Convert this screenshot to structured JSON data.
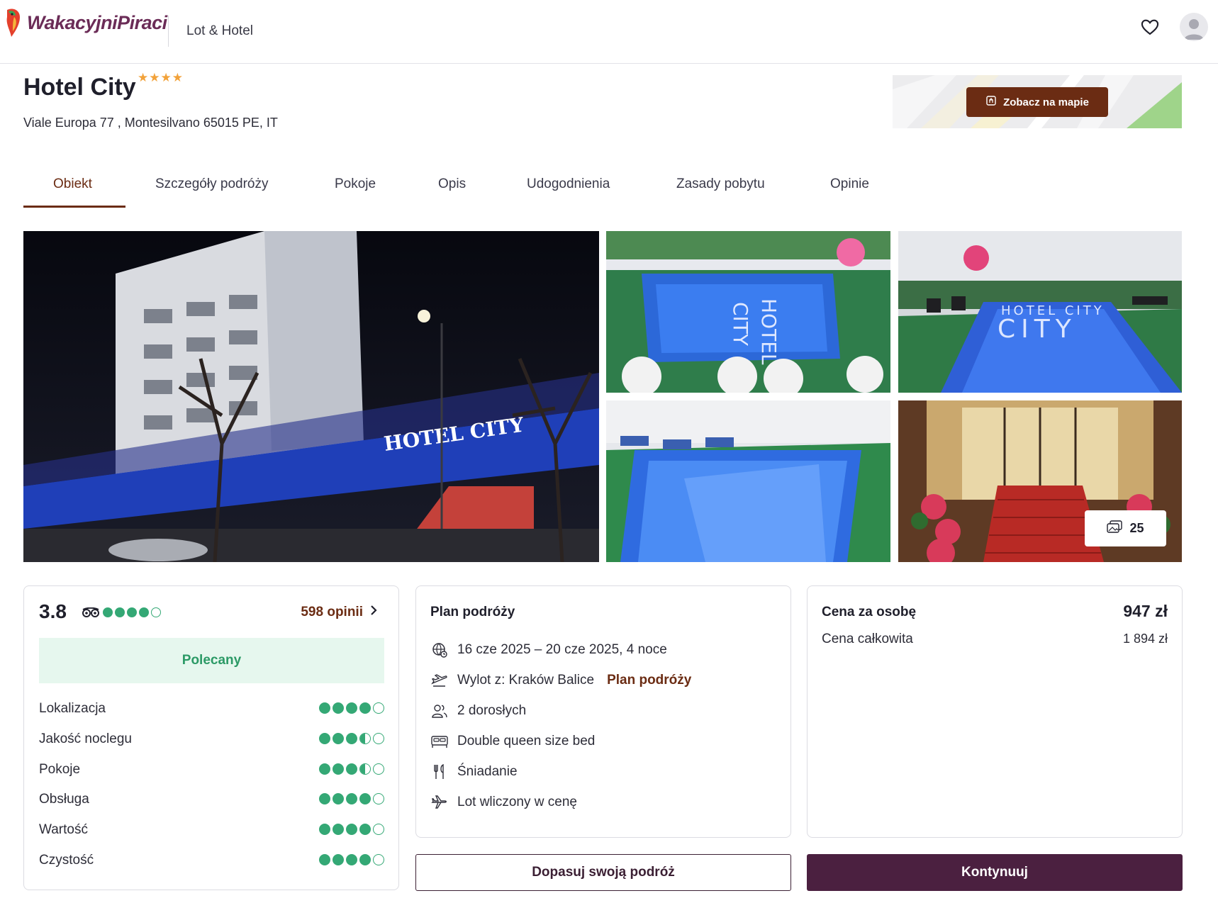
{
  "header": {
    "logo_text": "WakacyjniPiraci",
    "section": "Lot & Hotel",
    "favorites_icon": "heart-icon",
    "profile_icon": "user-avatar-icon"
  },
  "hotel": {
    "name": "Hotel City",
    "stars": 4,
    "stars_display": "★★★★",
    "address": "Viale Europa 77 , Montesilvano 65015 PE, IT",
    "map_button": "Zobacz na mapie"
  },
  "tabs": [
    {
      "label": "Obiekt",
      "active": true
    },
    {
      "label": "Szczegóły podróży",
      "active": false
    },
    {
      "label": "Pokoje",
      "active": false
    },
    {
      "label": "Opis",
      "active": false
    },
    {
      "label": "Udogodnienia",
      "active": false
    },
    {
      "label": "Zasady pobytu",
      "active": false
    },
    {
      "label": "Opinie",
      "active": false
    }
  ],
  "gallery": {
    "photo_count": "25",
    "main_sign": "HOTEL CITY",
    "pool_sign_top": "HOTEL CITY",
    "pool_sign_bottom": "CITY"
  },
  "rating": {
    "score": "3.8",
    "score_value": 3.8,
    "opinions": "598 opinii",
    "recommended": "Polecany",
    "criteria": [
      {
        "label": "Lokalizacja",
        "value": 4.0
      },
      {
        "label": "Jakość noclegu",
        "value": 3.5
      },
      {
        "label": "Pokoje",
        "value": 3.5
      },
      {
        "label": "Obsługa",
        "value": 4.0
      },
      {
        "label": "Wartość",
        "value": 4.0
      },
      {
        "label": "Czystość",
        "value": 4.0
      }
    ]
  },
  "plan": {
    "title": "Plan podróży",
    "dates": "16 cze 2025 – 20 cze 2025, 4 noce",
    "departure": "Wylot z: Kraków Balice",
    "departure_link": "Plan podróży",
    "guests": "2 dorosłych",
    "bed": "Double queen size bed",
    "meal": "Śniadanie",
    "flight": "Lot wliczony w cenę"
  },
  "price": {
    "per_person_label": "Cena za osobę",
    "per_person_value": "947 zł",
    "total_label": "Cena całkowita",
    "total_value": "1 894 zł"
  },
  "actions": {
    "customize": "Dopasuj swoją podróż",
    "continue": "Kontynuuj"
  },
  "colors": {
    "brand_purple": "#4b2040",
    "brand_brown": "#6b2c13",
    "rating_green": "#34a875",
    "star_orange": "#f2a23a"
  }
}
